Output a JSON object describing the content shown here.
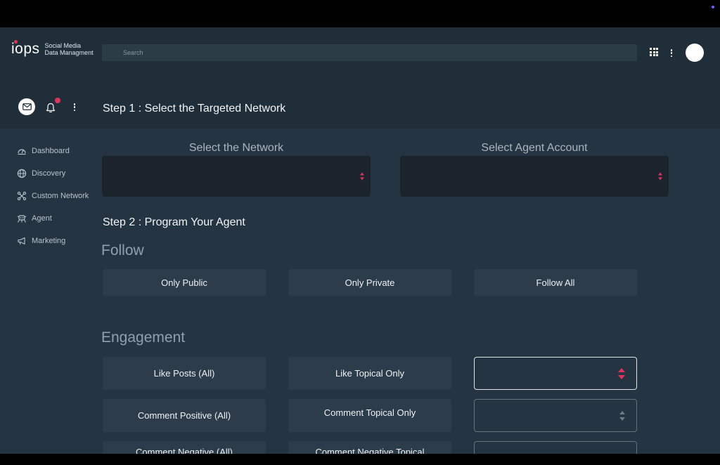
{
  "brand": {
    "logo": "iops",
    "line1": "Social Media",
    "line2": "Data Managment"
  },
  "search": {
    "placeholder": "Search",
    "value": ""
  },
  "colors": {
    "accent": "#e0335a",
    "header_bg": "#1f2e39",
    "content_bg": "#243442",
    "button_bg": "#2c3c4a",
    "select_bg": "#1b242c"
  },
  "icons": {
    "apps": "grid-icon",
    "more": "kebab-icon",
    "mail": "mail-icon",
    "notifications": "bell-icon"
  },
  "sidebar": {
    "items": [
      {
        "label": "Dashboard",
        "icon": "dashboard-icon"
      },
      {
        "label": "Discovery",
        "icon": "globe-icon"
      },
      {
        "label": "Custom Network",
        "icon": "network-icon"
      },
      {
        "label": "Agent",
        "icon": "agent-icon"
      },
      {
        "label": "Marketing",
        "icon": "megaphone-icon"
      }
    ]
  },
  "step1": {
    "title": "Step 1 : Select the Targeted Network",
    "network_label": "Select the Network",
    "agent_label": "Select Agent Account"
  },
  "step2": {
    "title": "Step 2 : Program Your Agent",
    "follow": {
      "title": "Follow",
      "options": [
        "Only Public",
        "Only Private",
        "Follow All"
      ]
    },
    "engagement": {
      "title": "Engagement",
      "like_all": "Like Posts (All)",
      "like_topical": "Like Topical Only",
      "comment_positive": "Comment Positive (All)",
      "comment_topical": "Comment Topical Only",
      "comment_negative_all": "Comment Negative (All)",
      "comment_negative_topical": "Comment Negative Topical"
    }
  }
}
